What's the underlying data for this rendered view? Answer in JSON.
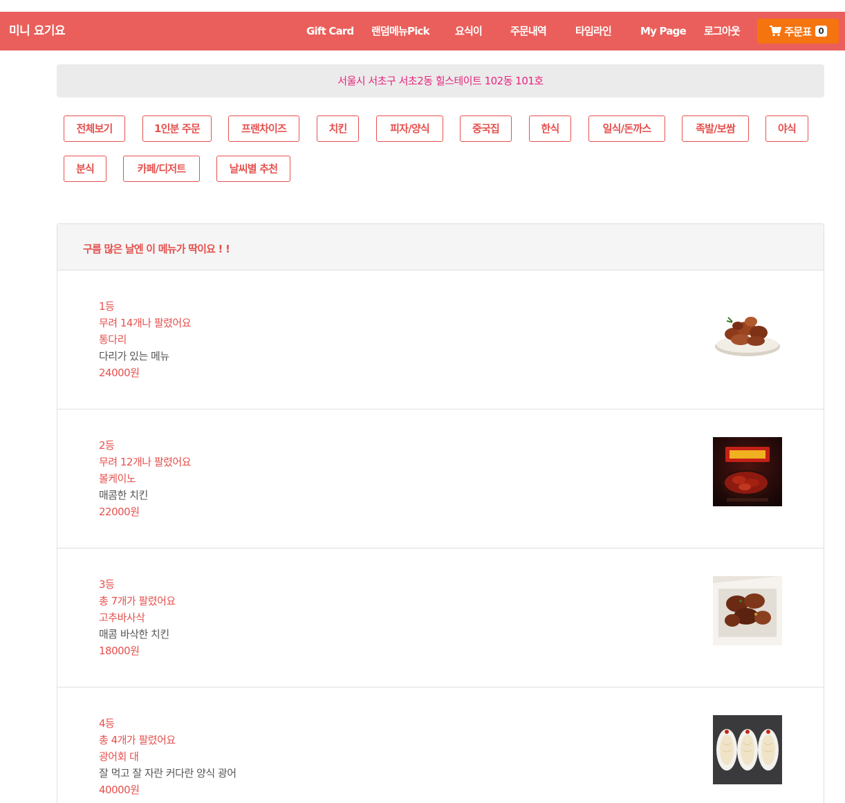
{
  "navbar": {
    "brand": "미니 요기요",
    "items": [
      "Gift Card",
      "랜덤메뉴Pick",
      "요식이",
      "주문내역",
      "타임라인",
      "My Page",
      "로그아웃"
    ],
    "cart_label": "주문표",
    "cart_count": "0",
    "cart_icon": "shopping-cart-icon",
    "colors": {
      "bar": "#ea5f5b",
      "cart": "#f5740f"
    }
  },
  "address": "서울시 서초구 서초2동 힐스테이트 102동 101호",
  "categories": [
    "전체보기",
    "1인분 주문",
    "프랜차이즈",
    "치킨",
    "피자/양식",
    "중국집",
    "한식",
    "일식/돈까스",
    "족발/보쌈",
    "야식",
    "분식",
    "카페/디저트",
    "날씨별 추천"
  ],
  "panel": {
    "title": "구름 많은 날엔 이 메뉴가 딱이요 ! !",
    "items": [
      {
        "rank": "1등",
        "sold": "무려 14개나 팔렸어요",
        "name": "통다리",
        "desc": "다리가 있는 메뉴",
        "price": "24000원"
      },
      {
        "rank": "2등",
        "sold": "무려 12개나 팔렸어요",
        "name": "볼케이노",
        "desc": "매콤한 치킨",
        "price": "22000원"
      },
      {
        "rank": "3등",
        "sold": "총 7개가 팔렸어요",
        "name": "고추바사삭",
        "desc": "매콤 바삭한 치킨",
        "price": "18000원"
      },
      {
        "rank": "4등",
        "sold": "총 4개가 팔렸어요",
        "name": "광어회 대",
        "desc": "잘 먹고 잘 자란 커다란 양식 광어",
        "price": "40000원"
      }
    ]
  },
  "theme": {
    "accent": "#e5504d",
    "address_text": "#e8237c"
  }
}
